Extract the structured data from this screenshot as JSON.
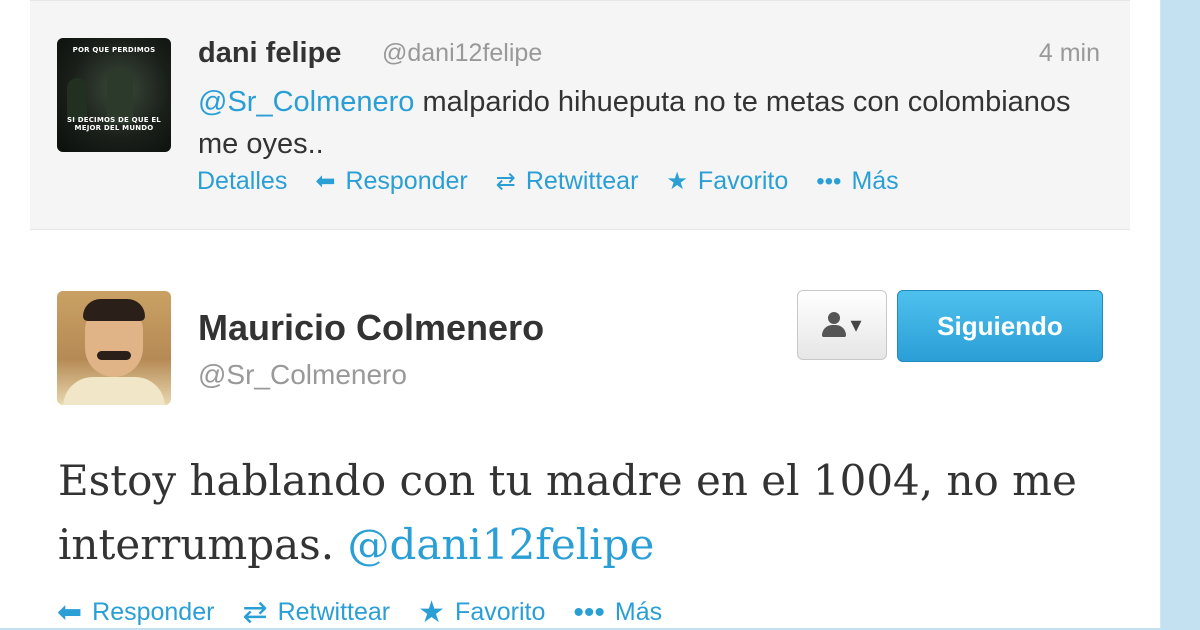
{
  "reply_tweet": {
    "avatar_caption_top": "POR QUE PERDIMOS",
    "avatar_caption_bottom": "SI DECIMOS DE QUE EL MEJOR DEL MUNDO",
    "author_name": "dani felipe",
    "author_handle": "@dani12felipe",
    "timestamp": "4 min",
    "mention": "@Sr_Colmenero",
    "text": " malparido hihueputa no te metas con colombianos me oyes..",
    "actions": {
      "details": "Detalles",
      "reply": "Responder",
      "retweet": "Retwittear",
      "favorite": "Favorito",
      "more": "Más"
    }
  },
  "main_tweet": {
    "author_name": "Mauricio Colmenero",
    "author_handle": "@Sr_Colmenero",
    "follow_button": "Siguiendo",
    "text": "Estoy hablando con tu madre en el 1004, no me interrumpas. ",
    "mention": "@dani12felipe",
    "actions": {
      "reply": "Responder",
      "retweet": "Retwittear",
      "favorite": "Favorito",
      "more": "Más"
    }
  },
  "icons": [
    "reply-arrow-icon",
    "retweet-icon",
    "star-icon",
    "dots-icon",
    "person-icon",
    "chevron-down-icon"
  ],
  "colors": {
    "link": "#2a9fd6",
    "follow_button": "#2a9fd6",
    "background": "#c4e1f2"
  }
}
